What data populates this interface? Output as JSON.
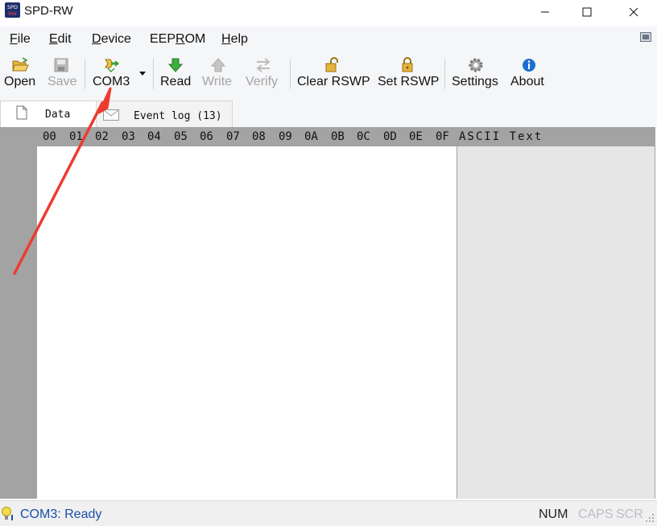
{
  "window": {
    "title": "SPD-RW",
    "icon_text_top": "SPD",
    "icon_text_bottom": "RW"
  },
  "menu": {
    "items": [
      {
        "label": "File",
        "mnemonic": "F",
        "rest": "ile"
      },
      {
        "label": "Edit",
        "mnemonic": "E",
        "rest": "dit"
      },
      {
        "label": "Device",
        "mnemonic": "D",
        "rest": "evice"
      },
      {
        "label": "EEPROM",
        "pre": "EEP",
        "mnemonic": "R",
        "rest": "OM"
      },
      {
        "label": "Help",
        "mnemonic": "H",
        "rest": "elp"
      }
    ]
  },
  "toolbar": {
    "open": "Open",
    "save": "Save",
    "com": "COM3",
    "read": "Read",
    "write": "Write",
    "verify": "Verify",
    "clear_rswp": "Clear RSWP",
    "set_rswp": "Set RSWP",
    "settings": "Settings",
    "about": "About"
  },
  "tabs": {
    "data": "Data",
    "event_log": "Event log (13)"
  },
  "hex_header": {
    "columns": [
      "00",
      "01",
      "02",
      "03",
      "04",
      "05",
      "06",
      "07",
      "08",
      "09",
      "0A",
      "0B",
      "0C",
      "0D",
      "0E",
      "0F"
    ],
    "ascii_label": "ASCII Text"
  },
  "status": {
    "message": "COM3: Ready",
    "num": "NUM",
    "caps": "CAPS",
    "scr": "SCR"
  },
  "colors": {
    "status_text": "#1a4fa8",
    "annotation_arrow": "#ee3b2f",
    "read_green": "#3cae3c",
    "about_blue": "#1b6fd1"
  }
}
